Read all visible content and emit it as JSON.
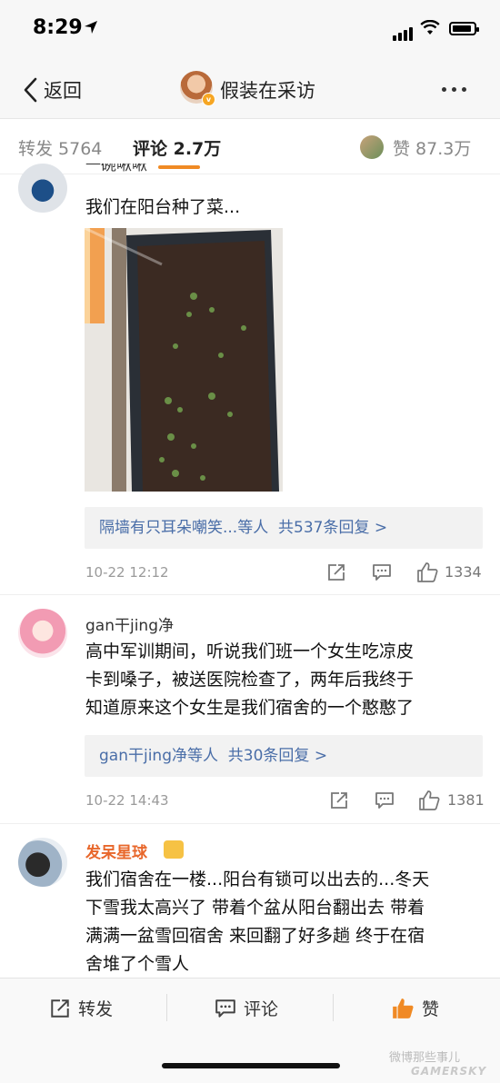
{
  "status_bar": {
    "time": "8:29"
  },
  "nav": {
    "back_label": "返回",
    "title": "假装在采访",
    "verified_badge": "v"
  },
  "tabs": {
    "repost": "转发 5764",
    "comment": "评论 2.7万",
    "likes": "赞 87.3万"
  },
  "comments": [
    {
      "username": "一碗啾啾",
      "text": "我们在阳台种了菜...",
      "replies": "隔墙有只耳朵嘲笑...等人  共537条回复 >",
      "date": "10-22 12:12",
      "like_count": "1334"
    },
    {
      "username": "gan干jing净",
      "text": "高中军训期间，听说我们班一个女生吃凉皮卡到嗓子，被送医院检查了，两年后我终于知道原来这个女生是我们宿舍的一个憨憨了",
      "text_lines": [
        "高中军训期间，听说我们班一个女生吃凉皮",
        "卡到嗓子，被送医院检查了，两年后我终于",
        "知道原来这个女生是我们宿舍的一个憨憨了"
      ],
      "replies": "gan干jing净等人  共30条回复 >",
      "date": "10-22 14:43",
      "like_count": "1381"
    },
    {
      "username": "发呆星球",
      "text_lines": [
        "我们宿舍在一楼...阳台有锁可以出去的...冬天",
        "下雪我太高兴了 带着个盆从阳台翻出去 带着",
        "满满一盆雪回宿舍 来回翻了好多趟 终于在宿",
        "舍堆了个雪人"
      ]
    }
  ],
  "bottom_bar": {
    "repost": "转发",
    "comment": "评论",
    "like": "赞"
  },
  "watermark": {
    "line1": "微博那些事儿",
    "line2": "GAMERSKY"
  },
  "colors": {
    "accent": "#f08a24",
    "link": "#4a6ea8",
    "vip_name": "#e8672b"
  }
}
